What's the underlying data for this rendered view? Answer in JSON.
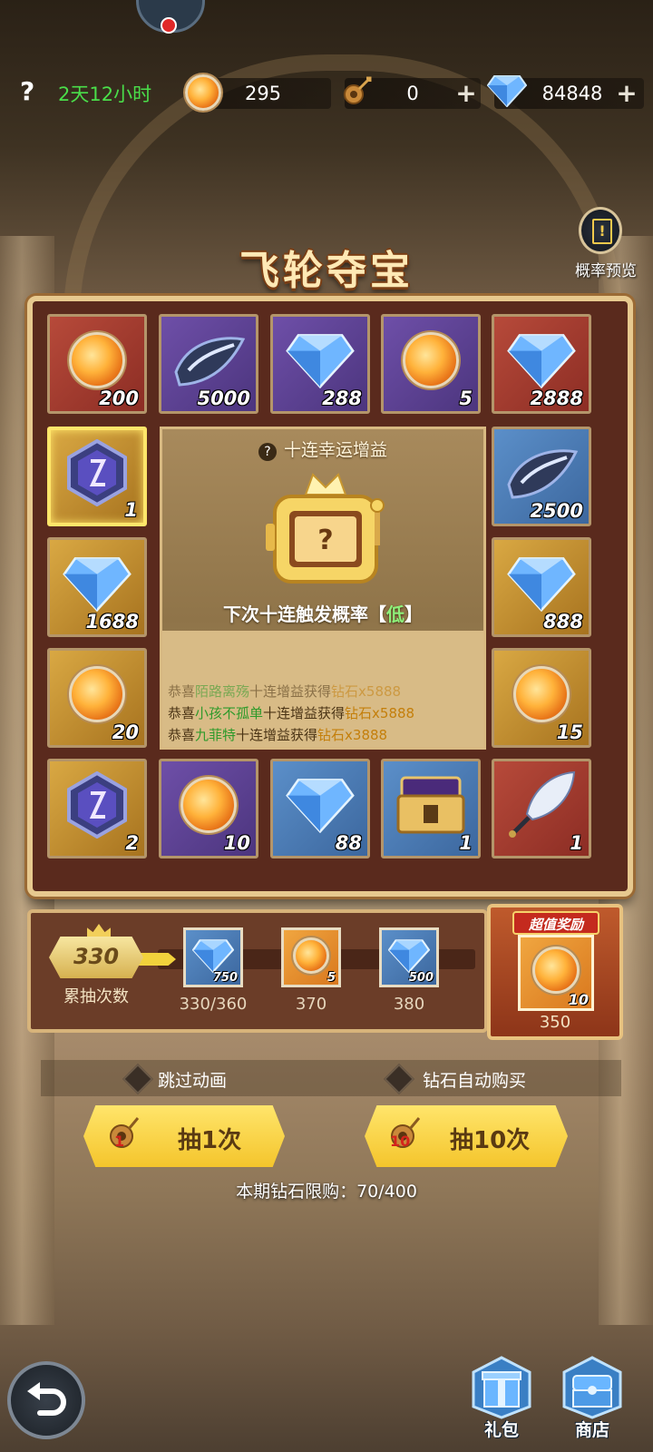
{
  "topbar": {
    "help_label": "?",
    "timer": "2天12小时",
    "orb_count": "295",
    "key_count": "0",
    "diamond_count": "84848"
  },
  "title": "飞轮夺宝",
  "preview": {
    "label": "概率预览"
  },
  "grid": {
    "top": [
      {
        "item": "orb",
        "bg": "red",
        "count": "200"
      },
      {
        "item": "feather",
        "bg": "purple",
        "count": "5000"
      },
      {
        "item": "diamond",
        "bg": "purple",
        "count": "288"
      },
      {
        "item": "orb",
        "bg": "purple",
        "count": "5"
      },
      {
        "item": "diamond",
        "bg": "red",
        "count": "2888"
      }
    ],
    "left": [
      {
        "item": "rune",
        "bg": "gold",
        "count": "1",
        "selected": true
      },
      {
        "item": "diamond",
        "bg": "gold",
        "count": "1688"
      },
      {
        "item": "orb",
        "bg": "gold",
        "count": "20"
      }
    ],
    "right": [
      {
        "item": "feather",
        "bg": "blue",
        "count": "2500"
      },
      {
        "item": "diamond",
        "bg": "gold",
        "count": "888"
      },
      {
        "item": "orb",
        "bg": "gold",
        "count": "15"
      }
    ],
    "bottom": [
      {
        "item": "rune",
        "bg": "gold",
        "count": "2"
      },
      {
        "item": "orb",
        "bg": "purple",
        "count": "10"
      },
      {
        "item": "diamond",
        "bg": "blue",
        "count": "88"
      },
      {
        "item": "chest",
        "bg": "blue",
        "count": "1"
      },
      {
        "item": "quill",
        "bg": "red",
        "count": "1"
      }
    ]
  },
  "center": {
    "title": "十连幸运增益",
    "rate_label": "下次十连触发概率【",
    "rate_value": "低",
    "rate_close": "】",
    "feed": [
      {
        "prefix": "恭喜",
        "name": "陌路离殇",
        "mid": "十连增益获得",
        "reward": "钻石x5888"
      },
      {
        "prefix": "恭喜",
        "name": "小孩不孤单",
        "mid": "十连增益获得",
        "reward": "钻石x5888"
      },
      {
        "prefix": "恭喜",
        "name": "九菲特",
        "mid": "十连增益获得",
        "reward": "钻石x3888"
      }
    ]
  },
  "progress": {
    "count": "330",
    "count_label": "累抽次数",
    "milestones": [
      {
        "item": "diamond",
        "amount": "750",
        "label": "330/360"
      },
      {
        "item": "orb",
        "amount": "5",
        "label": "370"
      },
      {
        "item": "diamond",
        "amount": "500",
        "label": "380"
      }
    ],
    "bonus_label": "超值奖励",
    "bonus_amount": "10",
    "bonus_threshold": "350"
  },
  "options": {
    "skip_animation": "跳过动画",
    "auto_buy": "钻石自动购买"
  },
  "buttons": {
    "draw1_label": "抽1次",
    "draw1_cost": "1",
    "draw10_label": "抽10次",
    "draw10_cost": "10"
  },
  "limit_text": "本期钻石限购：70/400",
  "dock": {
    "gift_label": "礼包",
    "shop_label": "商店"
  },
  "colors": {
    "timer": "#4ade4a",
    "button": "#f4c52c",
    "board_border": "#e7c98f"
  }
}
